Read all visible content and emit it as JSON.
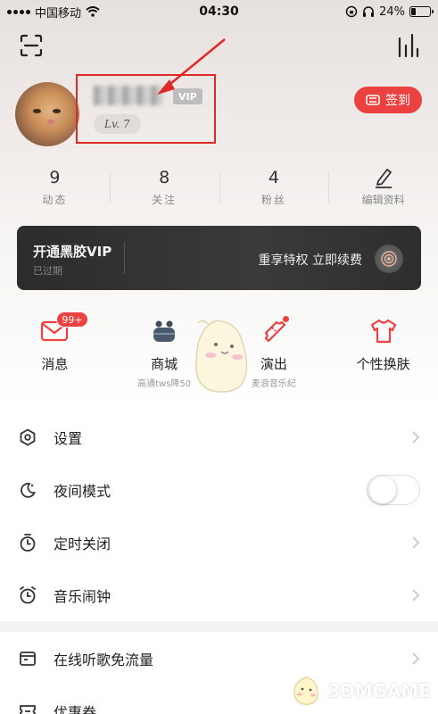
{
  "status_bar": {
    "carrier": "中国移动",
    "time": "04:30",
    "battery": "24%",
    "battery_level": 0.24
  },
  "profile": {
    "vip_badge": "VIP",
    "level": "Lv. 7",
    "checkin_label": "签到"
  },
  "stats": [
    {
      "value": "9",
      "label": "动态"
    },
    {
      "value": "8",
      "label": "关注"
    },
    {
      "value": "4",
      "label": "粉丝"
    },
    {
      "label": "编辑资料"
    }
  ],
  "vip_banner": {
    "title": "开通黑胶VIP",
    "subtitle": "已过期",
    "promo": "重享特权 立即续费"
  },
  "shortcuts": [
    {
      "label": "消息",
      "badge": "99+"
    },
    {
      "label": "商城",
      "sub": "高通tws降50"
    },
    {
      "label": "演出",
      "sub": "麦浪音乐纪"
    },
    {
      "label": "个性换肤"
    }
  ],
  "menu_group_1": [
    {
      "label": "设置"
    },
    {
      "label": "夜间模式"
    },
    {
      "label": "定时关闭"
    },
    {
      "label": "音乐闹钟"
    }
  ],
  "menu_group_2": [
    {
      "label": "在线听歌免流量"
    },
    {
      "label": "优惠券"
    }
  ],
  "watermark": {
    "text": "3DMGAME"
  },
  "colors": {
    "accent": "#ec4141",
    "highlight_box": "#e02a2a",
    "vip_banner_bg": "#2c2c2c"
  }
}
